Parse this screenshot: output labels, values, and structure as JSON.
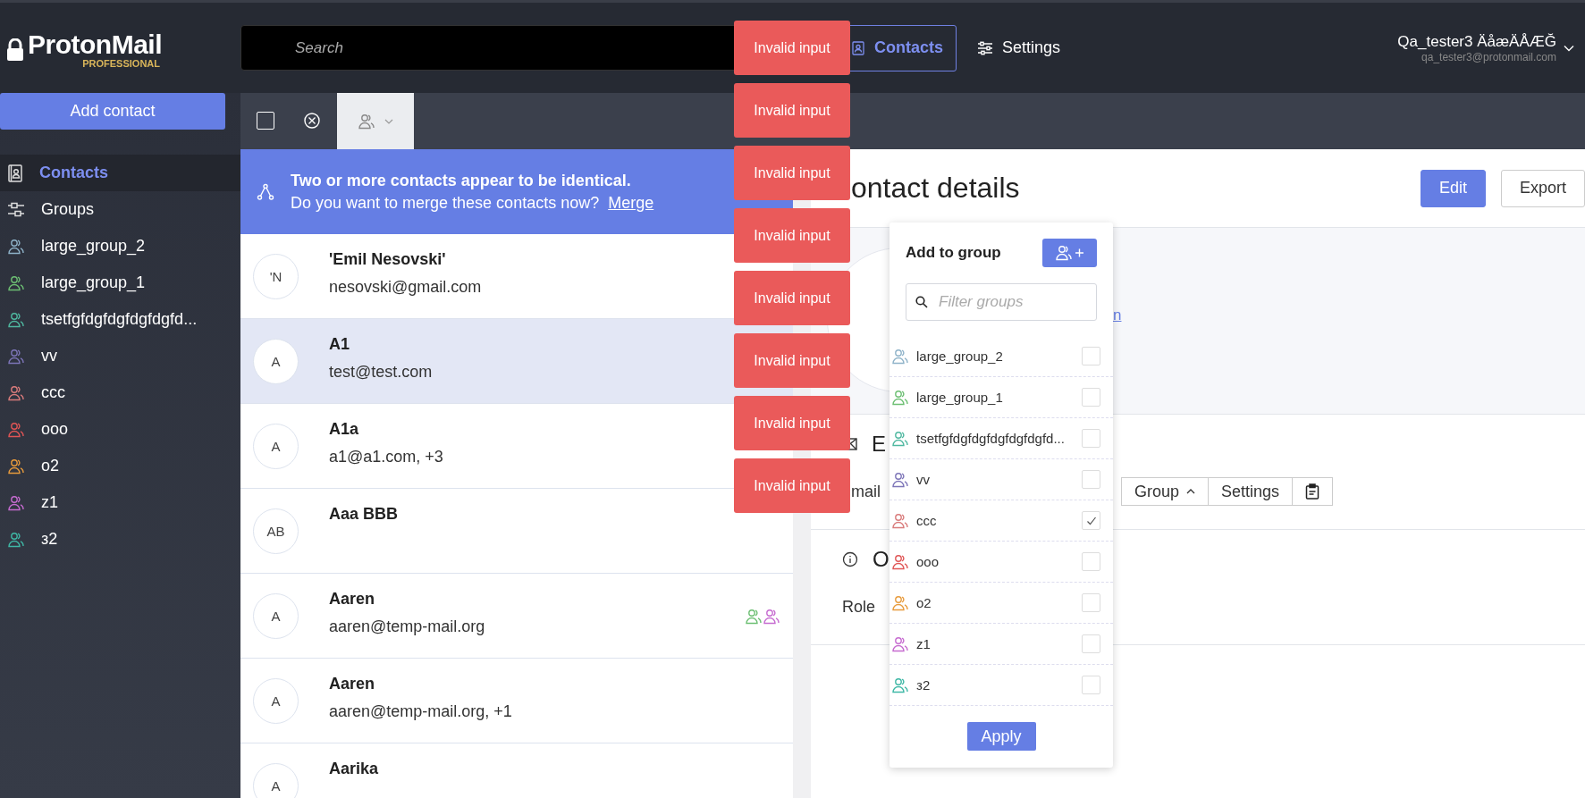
{
  "header": {
    "logo": {
      "name": "ProtonMail",
      "edition": "PROFESSIONAL"
    },
    "search": {
      "placeholder": "Search"
    },
    "nav": [
      {
        "label": "Contacts",
        "kind": "contacts",
        "selected": true
      },
      {
        "label": "Settings",
        "kind": "settings",
        "selected": false
      }
    ],
    "user": {
      "name": "Qa_tester3 ÄåæÄÅÆĞ",
      "email": "qa_tester3@protonmail.com"
    }
  },
  "sidebar": {
    "add_button": "Add contact",
    "items": [
      {
        "label": "Contacts",
        "kind": "contacts",
        "selected": true
      },
      {
        "label": "Groups",
        "kind": "groups",
        "selected": false
      },
      {
        "label": "large_group_2",
        "kind": "group",
        "selected": false,
        "color": "#8fb3c9"
      },
      {
        "label": "large_group_1",
        "kind": "group",
        "selected": false,
        "color": "#6dbf73"
      },
      {
        "label": "tsetfgfdgfdgfdgfdgfd...",
        "kind": "group",
        "selected": false,
        "color": "#4fb8a0"
      },
      {
        "label": "vv",
        "kind": "group",
        "selected": false,
        "color": "#7d75b8"
      },
      {
        "label": "ccc",
        "kind": "group",
        "selected": false,
        "color": "#d97b7b"
      },
      {
        "label": "ooo",
        "kind": "group",
        "selected": false,
        "color": "#e05555"
      },
      {
        "label": "o2",
        "kind": "group",
        "selected": false,
        "color": "#e89b3c"
      },
      {
        "label": "z1",
        "kind": "group",
        "selected": false,
        "color": "#c66bd0"
      },
      {
        "label": "з2",
        "kind": "group",
        "selected": false,
        "color": "#3fb8a6"
      }
    ]
  },
  "toolbar": {
    "select_all": {
      "checked": false
    },
    "group_filter": {
      "expanded": true
    }
  },
  "merge_banner": {
    "title": "Two or more contacts appear to be identical.",
    "text": "Do you want to merge these contacts now?",
    "link": "Merge"
  },
  "contacts": [
    {
      "initials": "'N",
      "name": "'Emil Nesovski'",
      "email": "nesovski@gmail.com",
      "selected": false
    },
    {
      "initials": "A",
      "name": "A1",
      "email": "test@test.com",
      "selected": true
    },
    {
      "initials": "A",
      "name": "A1a",
      "email": "a1@a1.com, +3",
      "selected": false
    },
    {
      "initials": "AB",
      "name": "Aaa BBB",
      "selected": false
    },
    {
      "initials": "A",
      "name": "Aaren",
      "email": "aaren@temp-mail.org",
      "selected": false,
      "groups": [
        {
          "color": "#6dbf73"
        },
        {
          "color": "#c66bd0"
        }
      ]
    },
    {
      "initials": "A",
      "name": "Aaren",
      "email": "aaren@temp-mail.org, +1",
      "selected": false
    },
    {
      "initials": "A",
      "name": "Aarika",
      "selected": false
    }
  ],
  "details": {
    "title": "ontact details",
    "buttons": [
      {
        "label": "Edit",
        "kind": "primary"
      },
      {
        "label": "Export",
        "kind": "secondary"
      }
    ],
    "link_fragment": "n",
    "email_section": {
      "heading": "E",
      "label": "mail",
      "actions": [
        {
          "label": "Group",
          "kind": "dropdown"
        },
        {
          "label": "Settings",
          "kind": "text"
        },
        {
          "kind": "clipboard"
        }
      ]
    },
    "other_section": {
      "heading": "O",
      "label": "Role"
    }
  },
  "group_popover": {
    "title": "Add to group",
    "filter": {
      "placeholder": "Filter groups"
    },
    "items": [
      {
        "label": "large_group_2",
        "color": "#8fb3c9",
        "checked": false
      },
      {
        "label": "large_group_1",
        "color": "#6dbf73",
        "checked": false
      },
      {
        "label": "tsetfgfdgfdgfdgfdgfdgfd...",
        "color": "#4fb8a0",
        "checked": false
      },
      {
        "label": "vv",
        "color": "#7d75b8",
        "checked": false
      },
      {
        "label": "ccc",
        "color": "#d97b7b",
        "checked": true
      },
      {
        "label": "ooo",
        "color": "#e05555",
        "checked": false
      },
      {
        "label": "o2",
        "color": "#e89b3c",
        "checked": false
      },
      {
        "label": "z1",
        "color": "#c66bd0",
        "checked": false
      },
      {
        "label": "з2",
        "color": "#3fb8a6",
        "checked": false
      }
    ],
    "apply": "Apply"
  },
  "toasts": [
    "Invalid input",
    "Invalid input",
    "Invalid input",
    "Invalid input",
    "Invalid input",
    "Invalid input",
    "Invalid input",
    "Invalid input"
  ]
}
